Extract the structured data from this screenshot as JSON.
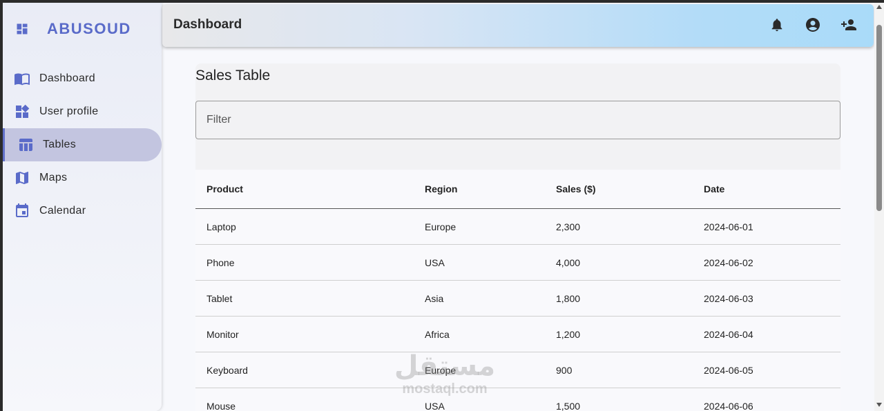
{
  "brand": {
    "name": "ABUSOUD",
    "icon": "dashboard-grid-icon"
  },
  "sidebar": {
    "items": [
      {
        "label": "Dashboard",
        "icon": "menu-book-icon",
        "active": false
      },
      {
        "label": "User profile",
        "icon": "widgets-icon",
        "active": false
      },
      {
        "label": "Tables",
        "icon": "table-icon",
        "active": true
      },
      {
        "label": "Maps",
        "icon": "map-icon",
        "active": false
      },
      {
        "label": "Calendar",
        "icon": "calendar-icon",
        "active": false
      }
    ]
  },
  "header": {
    "title": "Dashboard",
    "buttons": [
      "bell-icon",
      "account-circle-icon",
      "person-add-icon"
    ]
  },
  "card": {
    "title": "Sales Table",
    "filter_placeholder": "Filter"
  },
  "table": {
    "columns": [
      "Product",
      "Region",
      "Sales ($)",
      "Date"
    ],
    "rows": [
      [
        "Laptop",
        "Europe",
        "2,300",
        "2024-06-01"
      ],
      [
        "Phone",
        "USA",
        "4,000",
        "2024-06-02"
      ],
      [
        "Tablet",
        "Asia",
        "1,800",
        "2024-06-03"
      ],
      [
        "Monitor",
        "Africa",
        "1,200",
        "2024-06-04"
      ],
      [
        "Keyboard",
        "Europe",
        "900",
        "2024-06-05"
      ],
      [
        "Mouse",
        "USA",
        "1,500",
        "2024-06-06"
      ]
    ]
  },
  "watermark": {
    "arabic": "مستقل",
    "latin": "mostaql.com"
  },
  "colors": {
    "accent": "#5a6bc9",
    "active_bg": "#c3c5e0",
    "header_end": "#a9dbf9"
  }
}
